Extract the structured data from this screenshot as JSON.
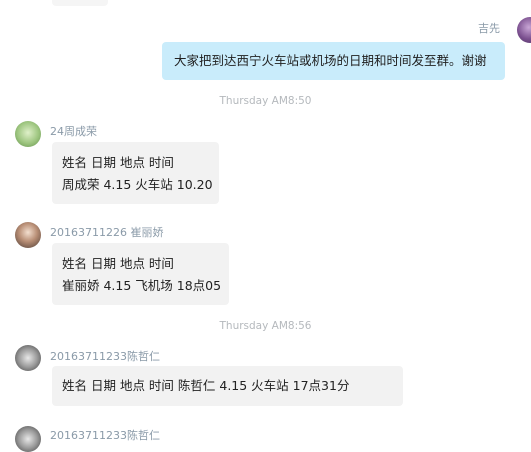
{
  "self_message": {
    "sender": "吉先",
    "text": "大家把到达西宁火车站或机场的日期和时间发至群。谢谢"
  },
  "timestamps": [
    "Thursday  AM8:50",
    "Thursday  AM8:56"
  ],
  "messages": [
    {
      "sender": "24周成荣",
      "lines": [
        "姓名    日期    地点    时间",
        "周成荣 4.15 火车站 10.20"
      ]
    },
    {
      "sender": "20163711226 崔丽娇",
      "lines": [
        "姓名     日期    地点    时间",
        "崔丽娇 4.15 飞机场 18点05"
      ]
    },
    {
      "sender": "20163711233陈哲仁",
      "lines": [
        "姓名     日期    地点    时间    陈哲仁   4.15 火车站 17点31分"
      ]
    },
    {
      "sender": "20163711233陈哲仁"
    }
  ]
}
